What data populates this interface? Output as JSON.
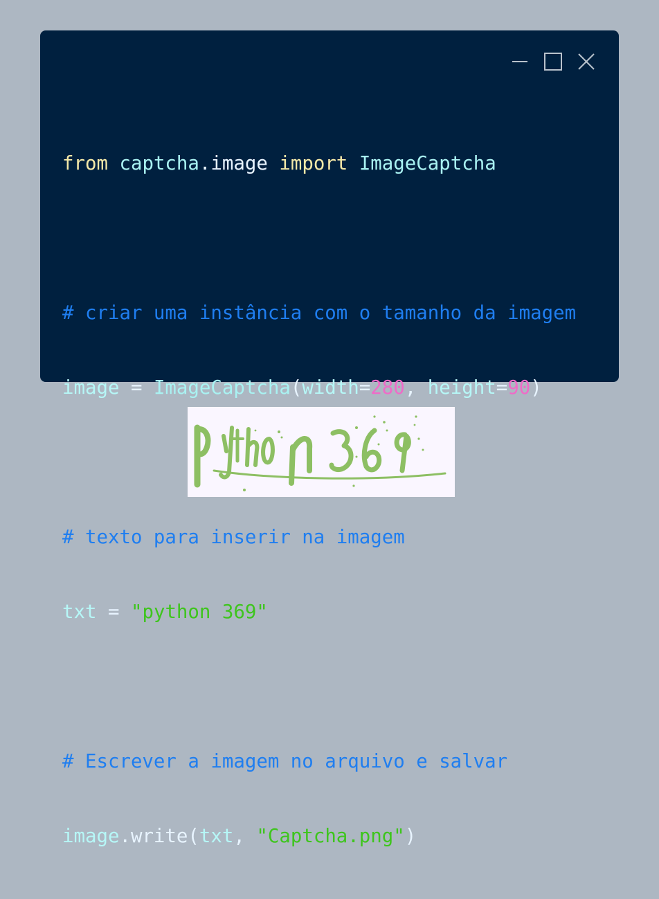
{
  "window": {
    "controls": {
      "minimize_icon": "minimize-icon",
      "maximize_icon": "maximize-icon",
      "close_icon": "close-icon"
    }
  },
  "code": {
    "line1": {
      "kw1": "from",
      "mod": "captcha",
      "dot": ".",
      "sub": "image",
      "kw2": "import",
      "cls": "ImageCaptcha"
    },
    "line3": {
      "comment": "# criar uma instância com o tamanho da imagem"
    },
    "line4": {
      "var": "image",
      "eq": " = ",
      "cls": "ImageCaptcha",
      "open": "(",
      "arg1": "width",
      "eq1": "=",
      "val1": "280",
      "sep": ", ",
      "arg2": "height",
      "eq2": "=",
      "val2": "90",
      "close": ")"
    },
    "line6": {
      "comment": "# texto para inserir na imagem"
    },
    "line7": {
      "var": "txt",
      "eq": " = ",
      "str": "\"python 369\""
    },
    "line9": {
      "comment": "# Escrever a imagem no arquivo e salvar"
    },
    "line10": {
      "var": "image",
      "dot": ".",
      "fn": "write",
      "open": "(",
      "arg": "txt",
      "sep": ", ",
      "str": "\"Captcha.png\"",
      "close": ")"
    }
  },
  "captcha": {
    "text": "python 369",
    "color": "#8dbf63",
    "background": "#faf6ff"
  },
  "colors": {
    "page_background": "#adb7c2",
    "window_background": "#00203f",
    "keyword": "#f4e9a8",
    "comment": "#1f7ef0",
    "number": "#f06ac8",
    "string": "#3ec51d",
    "identifier": "#b6f7f7"
  }
}
